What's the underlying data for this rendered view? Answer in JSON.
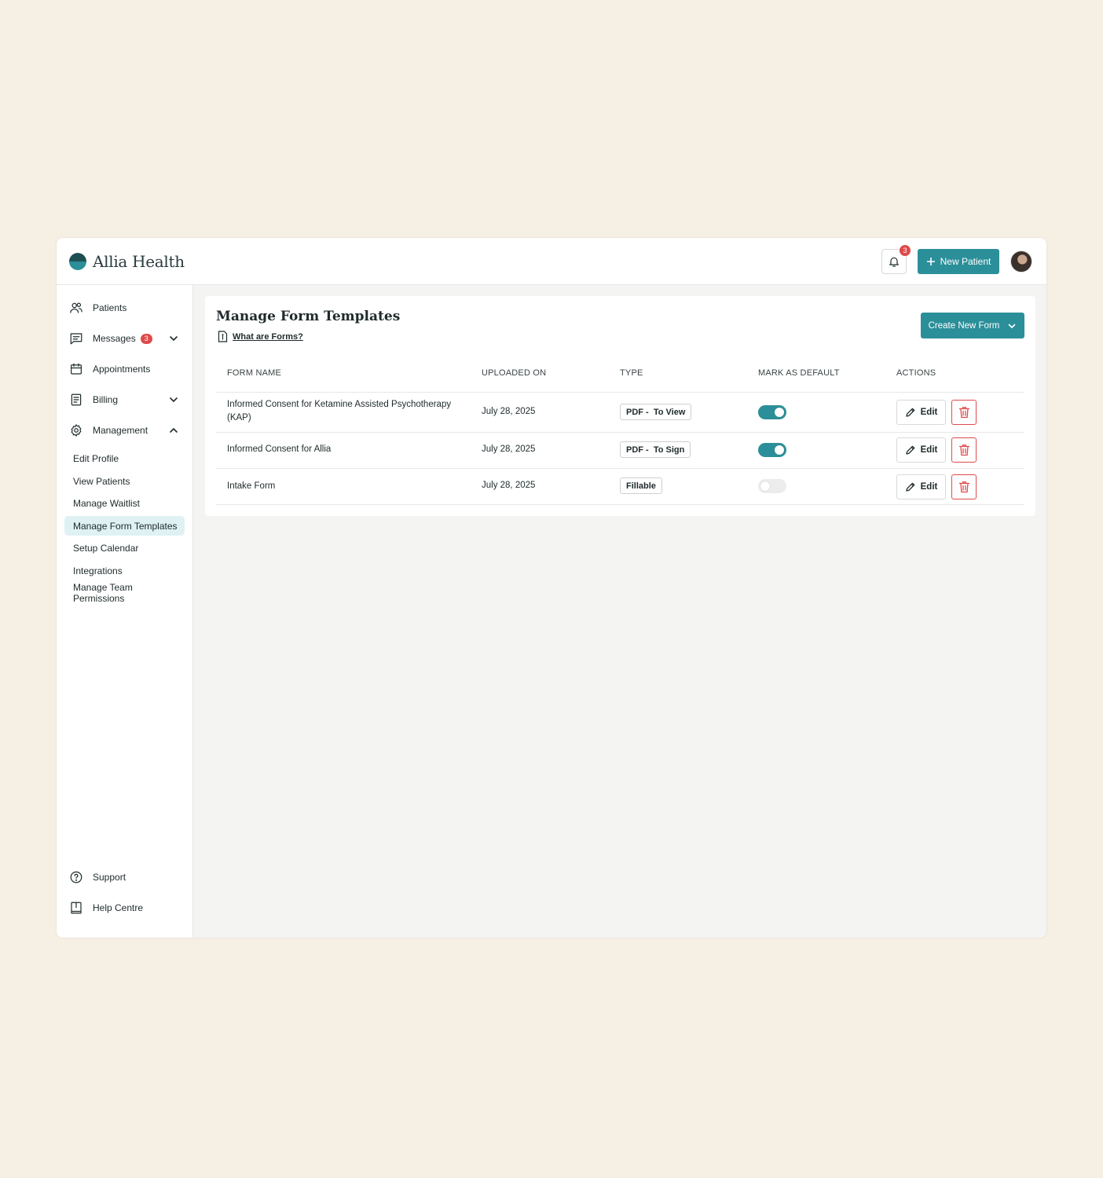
{
  "header": {
    "logo_text": "Allia Health",
    "notification_count": "3",
    "new_patient_label": "New Patient"
  },
  "sidebar": {
    "items": [
      {
        "label": "Patients",
        "icon": "users-icon"
      },
      {
        "label": "Messages",
        "icon": "message-icon",
        "badge": "3"
      },
      {
        "label": "Appointments",
        "icon": "calendar-icon"
      },
      {
        "label": "Billing",
        "icon": "document-icon"
      },
      {
        "label": "Management",
        "icon": "gear-icon"
      }
    ],
    "management_subitems": [
      "Edit Profile",
      "View Patients",
      "Manage Waitlist",
      "Manage Form Templates",
      "Setup Calendar",
      "Integrations",
      "Manage Team Permissions"
    ],
    "active_subitem": "Manage Form Templates",
    "footer_items": [
      {
        "label": "Support",
        "icon": "help-circle-icon"
      },
      {
        "label": "Help Centre",
        "icon": "book-icon"
      }
    ]
  },
  "main": {
    "title": "Manage Form Templates",
    "what_link": "What are Forms?",
    "create_button": "Create New Form",
    "columns": [
      "FORM NAME",
      "UPLOADED ON",
      "TYPE",
      "MARK AS DEFAULT",
      "ACTIONS"
    ],
    "rows": [
      {
        "name_line1": "Informed Consent for Ketamine Assisted Psychotherapy",
        "name_line2": "(KAP)",
        "uploaded": "July 28, 2025",
        "type": "PDF -  To View",
        "default": true,
        "edit_label": "Edit"
      },
      {
        "name_line1": "Informed Consent for Allia",
        "name_line2": "",
        "uploaded": "July 28, 2025",
        "type": "PDF -  To Sign",
        "default": true,
        "edit_label": "Edit"
      },
      {
        "name_line1": "Intake Form",
        "name_line2": "",
        "uploaded": "July 28, 2025",
        "type": "Fillable",
        "default": false,
        "edit_label": "Edit"
      }
    ]
  },
  "colors": {
    "accent": "#2b8f99",
    "danger": "#e04a4a",
    "active_bg": "#dff1f3",
    "page_bg": "#f5efe4"
  }
}
